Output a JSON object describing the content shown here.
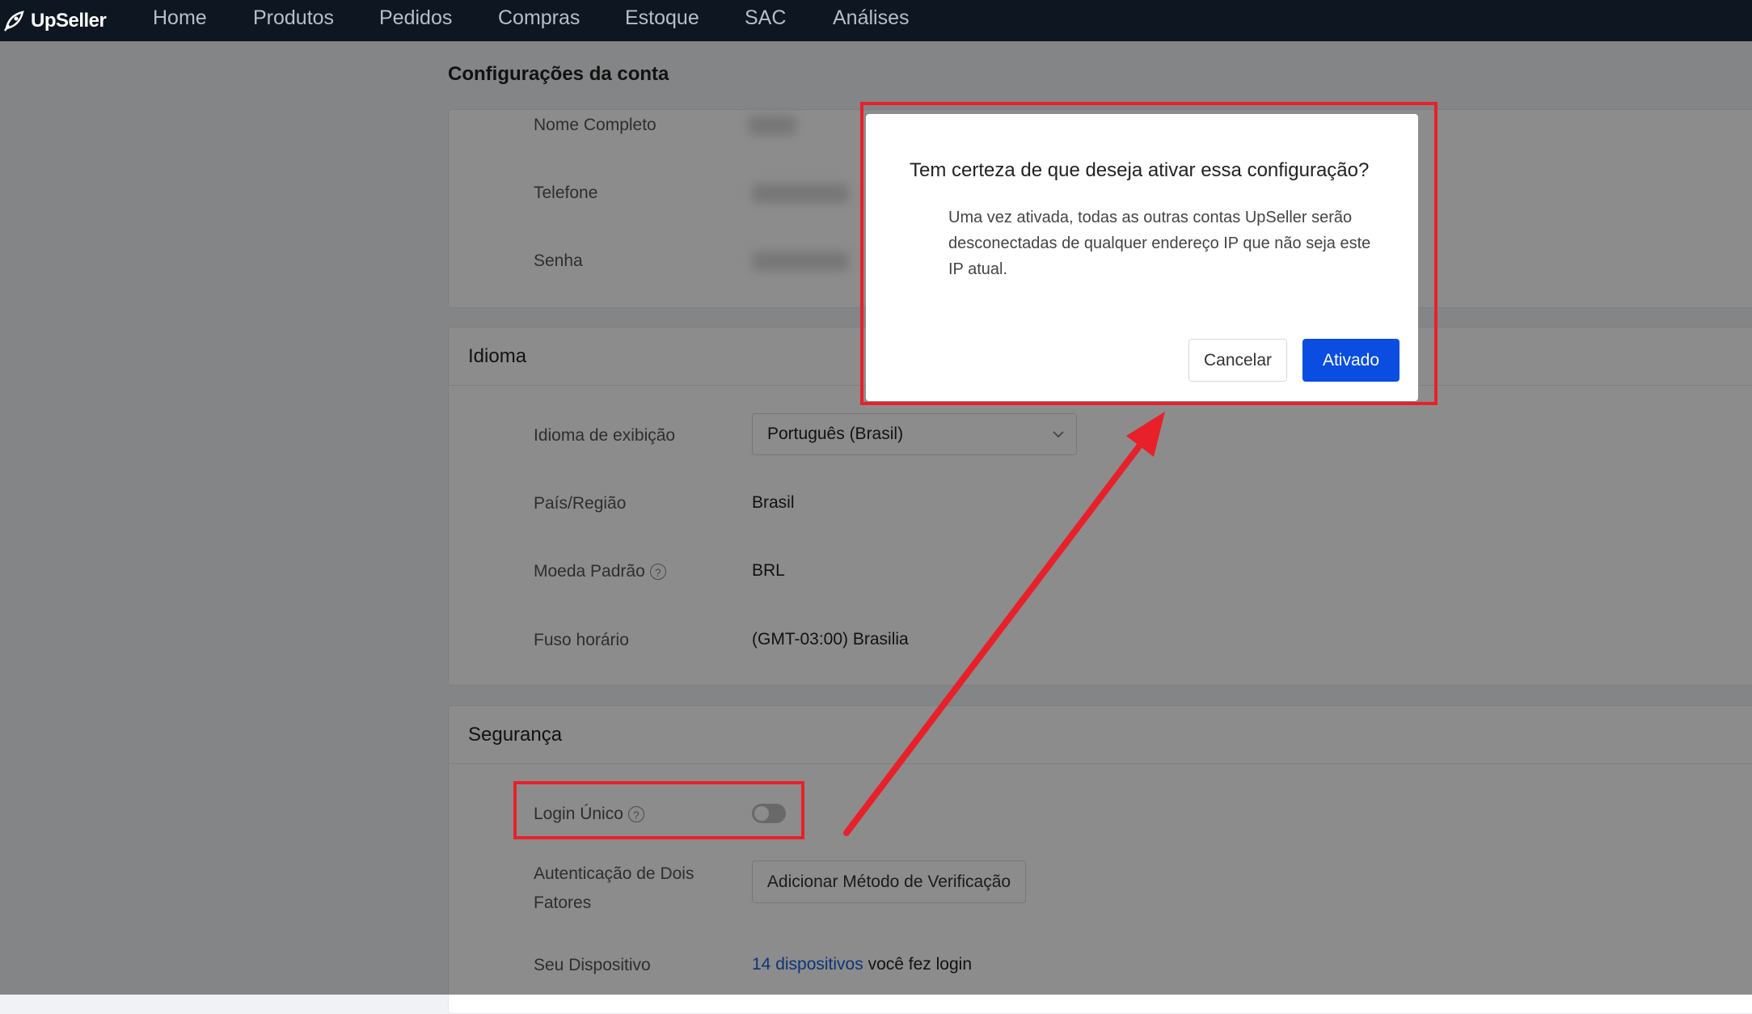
{
  "app": {
    "name": "UpSeller"
  },
  "nav": {
    "items": [
      "Home",
      "Produtos",
      "Pedidos",
      "Compras",
      "Estoque",
      "SAC",
      "Análises"
    ]
  },
  "page": {
    "title": "Configurações da conta"
  },
  "account": {
    "full_name_label": "Nome Completo",
    "phone_label": "Telefone",
    "password_label": "Senha"
  },
  "language": {
    "title": "Idioma",
    "display_language_label": "Idioma de exibição",
    "display_language_value": "Português (Brasil)",
    "country_label": "País/Região",
    "country_value": "Brasil",
    "currency_label": "Moeda Padrão",
    "currency_value": "BRL",
    "timezone_label": "Fuso horário",
    "timezone_value": "(GMT-03:00) Brasilia"
  },
  "security": {
    "title": "Segurança",
    "single_login_label": "Login Único",
    "single_login_enabled": false,
    "two_factor_label_line1": "Autenticação de Dois",
    "two_factor_label_line2": "Fatores",
    "two_factor_button": "Adicionar Método de Verificação",
    "device_label": "Seu Dispositivo",
    "device_link": "14 dispositivos",
    "device_text": " você fez login"
  },
  "modal": {
    "title": "Tem certeza de que deseja ativar essa configuração?",
    "body": "Uma vez ativada, todas as outras contas UpSeller serão desconectadas de qualquer endereço IP que não seja este IP atual.",
    "cancel_label": "Cancelar",
    "confirm_label": "Ativado"
  },
  "colors": {
    "nav_bg": "#0e1622",
    "primary": "#0a4de0",
    "annotation": "#e8202a",
    "link": "#1a5fd6"
  },
  "icons": {
    "logo": "rocket-logo-icon",
    "help": "question-circle-icon",
    "dropdown": "chevron-down-icon"
  }
}
